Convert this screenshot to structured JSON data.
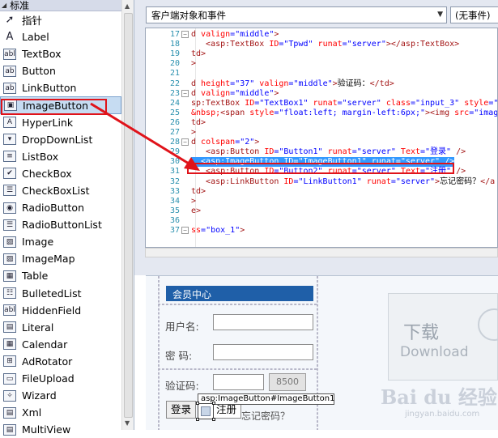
{
  "toolbox": {
    "header": "标准",
    "items": [
      {
        "label": "指针",
        "icon": "pointer-icon",
        "glyph": "➚"
      },
      {
        "label": "Label",
        "icon": "label-icon",
        "glyph": "A"
      },
      {
        "label": "TextBox",
        "icon": "textbox-icon",
        "glyph": "abl"
      },
      {
        "label": "Button",
        "icon": "button-icon",
        "glyph": "ab"
      },
      {
        "label": "LinkButton",
        "icon": "linkbutton-icon",
        "glyph": "ab"
      },
      {
        "label": "ImageButton",
        "icon": "imagebutton-icon",
        "glyph": "▣"
      },
      {
        "label": "HyperLink",
        "icon": "hyperlink-icon",
        "glyph": "A"
      },
      {
        "label": "DropDownList",
        "icon": "dropdownlist-icon",
        "glyph": "▾"
      },
      {
        "label": "ListBox",
        "icon": "listbox-icon",
        "glyph": "≡"
      },
      {
        "label": "CheckBox",
        "icon": "checkbox-icon",
        "glyph": "✔"
      },
      {
        "label": "CheckBoxList",
        "icon": "checkboxlist-icon",
        "glyph": "☰"
      },
      {
        "label": "RadioButton",
        "icon": "radiobutton-icon",
        "glyph": "◉"
      },
      {
        "label": "RadioButtonList",
        "icon": "radiobuttonlist-icon",
        "glyph": "☰"
      },
      {
        "label": "Image",
        "icon": "image-icon",
        "glyph": "▨"
      },
      {
        "label": "ImageMap",
        "icon": "imagemap-icon",
        "glyph": "▨"
      },
      {
        "label": "Table",
        "icon": "table-icon",
        "glyph": "▦"
      },
      {
        "label": "BulletedList",
        "icon": "bulletedlist-icon",
        "glyph": "☷"
      },
      {
        "label": "HiddenField",
        "icon": "hiddenfield-icon",
        "glyph": "abl"
      },
      {
        "label": "Literal",
        "icon": "literal-icon",
        "glyph": "▤"
      },
      {
        "label": "Calendar",
        "icon": "calendar-icon",
        "glyph": "▦"
      },
      {
        "label": "AdRotator",
        "icon": "adrotator-icon",
        "glyph": "⊞"
      },
      {
        "label": "FileUpload",
        "icon": "fileupload-icon",
        "glyph": "▭"
      },
      {
        "label": "Wizard",
        "icon": "wizard-icon",
        "glyph": "✧"
      },
      {
        "label": "Xml",
        "icon": "xml-icon",
        "glyph": "▤"
      },
      {
        "label": "MultiView",
        "icon": "multiview-icon",
        "glyph": "▤"
      }
    ],
    "selected_index": 5
  },
  "editor": {
    "object_select": "客户端对象和事件",
    "event_select": "(无事件)",
    "lines": [
      {
        "n": "17",
        "fold": "⊟",
        "segs": [
          [
            "k",
            "d "
          ],
          [
            "a",
            "valign"
          ],
          [
            "v",
            "=\"middle\""
          ],
          [
            "k",
            ">"
          ]
        ]
      },
      {
        "n": "18",
        "fold": "",
        "segs": [
          [
            "k",
            "   <asp:TextBox "
          ],
          [
            "a",
            "ID"
          ],
          [
            "v",
            "=\"Tpwd\" "
          ],
          [
            "a",
            "runat"
          ],
          [
            "v",
            "=\"server\""
          ],
          [
            "k",
            "></asp:TextBox>"
          ]
        ]
      },
      {
        "n": "19",
        "fold": "",
        "segs": [
          [
            "k",
            "td>"
          ]
        ]
      },
      {
        "n": "20",
        "fold": "",
        "segs": [
          [
            "k",
            ">"
          ]
        ]
      },
      {
        "n": "21",
        "fold": "",
        "segs": [
          [
            "k",
            ""
          ]
        ]
      },
      {
        "n": "22",
        "fold": "",
        "segs": [
          [
            "k",
            "d "
          ],
          [
            "a",
            "height"
          ],
          [
            "v",
            "=\"37\" "
          ],
          [
            "a",
            "valign"
          ],
          [
            "v",
            "=\"middle\""
          ],
          [
            "k",
            ">"
          ],
          [
            "t",
            "验证码："
          ],
          [
            "k",
            "</td>"
          ]
        ]
      },
      {
        "n": "23",
        "fold": "⊟",
        "segs": [
          [
            "k",
            "d "
          ],
          [
            "a",
            "valign"
          ],
          [
            "v",
            "=\"middle\""
          ],
          [
            "k",
            ">"
          ]
        ]
      },
      {
        "n": "24",
        "fold": "",
        "segs": [
          [
            "k",
            "sp:TextBox "
          ],
          [
            "a",
            "ID"
          ],
          [
            "v",
            "=\"TextBox1\" "
          ],
          [
            "a",
            "runat"
          ],
          [
            "v",
            "=\"server\" "
          ],
          [
            "a",
            "class"
          ],
          [
            "v",
            "=\"input_3\" "
          ],
          [
            "a",
            "style"
          ],
          [
            "v",
            "=\""
          ]
        ]
      },
      {
        "n": "25",
        "fold": "",
        "segs": [
          [
            "a",
            "&nbsp;"
          ],
          [
            "k",
            "<span "
          ],
          [
            "a",
            "style"
          ],
          [
            "v",
            "=\"float:left; margin-left:6px;\""
          ],
          [
            "k",
            "><img "
          ],
          [
            "a",
            "src"
          ],
          [
            "v",
            "=\"imag"
          ]
        ]
      },
      {
        "n": "26",
        "fold": "",
        "segs": [
          [
            "k",
            "td>"
          ]
        ]
      },
      {
        "n": "27",
        "fold": "",
        "segs": [
          [
            "k",
            ">"
          ]
        ]
      },
      {
        "n": "28",
        "fold": "⊟",
        "segs": [
          [
            "k",
            "d "
          ],
          [
            "a",
            "colspan"
          ],
          [
            "v",
            "=\"2\""
          ],
          [
            "k",
            ">"
          ]
        ]
      },
      {
        "n": "29",
        "fold": "",
        "segs": [
          [
            "k",
            "   <asp:Button "
          ],
          [
            "a",
            "ID"
          ],
          [
            "v",
            "=\"Button1\" "
          ],
          [
            "a",
            "runat"
          ],
          [
            "v",
            "=\"server\" "
          ],
          [
            "a",
            "Text"
          ],
          [
            "v",
            "=\"登录\" "
          ],
          [
            "k",
            "/>"
          ]
        ]
      },
      {
        "n": "30",
        "fold": "",
        "hl": true,
        "segs": [
          [
            "h",
            "  <asp:ImageButton ID=\"ImageButton1\" runat=\"server\" />"
          ]
        ]
      },
      {
        "n": "31",
        "fold": "",
        "segs": [
          [
            "k",
            "   <asp:Button "
          ],
          [
            "a",
            "ID"
          ],
          [
            "v",
            "=\"Button2\" "
          ],
          [
            "a",
            "runat"
          ],
          [
            "v",
            "=\"server\" "
          ],
          [
            "a",
            "Text"
          ],
          [
            "v",
            "=\"注册\" "
          ],
          [
            "k",
            "/>"
          ]
        ]
      },
      {
        "n": "32",
        "fold": "",
        "segs": [
          [
            "k",
            "   <asp:LinkButton "
          ],
          [
            "a",
            "ID"
          ],
          [
            "v",
            "=\"LinkButton1\" "
          ],
          [
            "a",
            "runat"
          ],
          [
            "v",
            "=\"server\""
          ],
          [
            "k",
            ">"
          ],
          [
            "t",
            "忘记密码？"
          ],
          [
            "k",
            "</a"
          ]
        ]
      },
      {
        "n": "33",
        "fold": "",
        "segs": [
          [
            "k",
            "td>"
          ]
        ]
      },
      {
        "n": "34",
        "fold": "",
        "segs": [
          [
            "k",
            ">"
          ]
        ]
      },
      {
        "n": "35",
        "fold": "",
        "segs": [
          [
            "k",
            "e>"
          ]
        ]
      },
      {
        "n": "36",
        "fold": "",
        "segs": [
          [
            "k",
            ""
          ]
        ]
      },
      {
        "n": "37",
        "fold": "⊟",
        "segs": [
          [
            "a",
            "ss"
          ],
          [
            "v",
            "=\"box_1\""
          ],
          [
            "k",
            ">"
          ]
        ]
      }
    ]
  },
  "design": {
    "member_header": "会员中心",
    "username_label": "用户名:",
    "password_label": "密  码:",
    "captcha_label": "验证码:",
    "captcha_text": "8500",
    "login_button": "登录",
    "register_button": "注册",
    "forgot_link": "忘记密码？",
    "imagebutton_tag": "asp:ImageButton#ImageButton1",
    "banner_cn": "下载",
    "banner_en": "Download",
    "watermark": "Bai du 经验",
    "watermark_url": "jingyan.baidu.com"
  },
  "colors": {
    "highlight_red": "#e0131a",
    "selection_blue": "#3399ff",
    "member_header_bg": "#1f5fa8"
  }
}
